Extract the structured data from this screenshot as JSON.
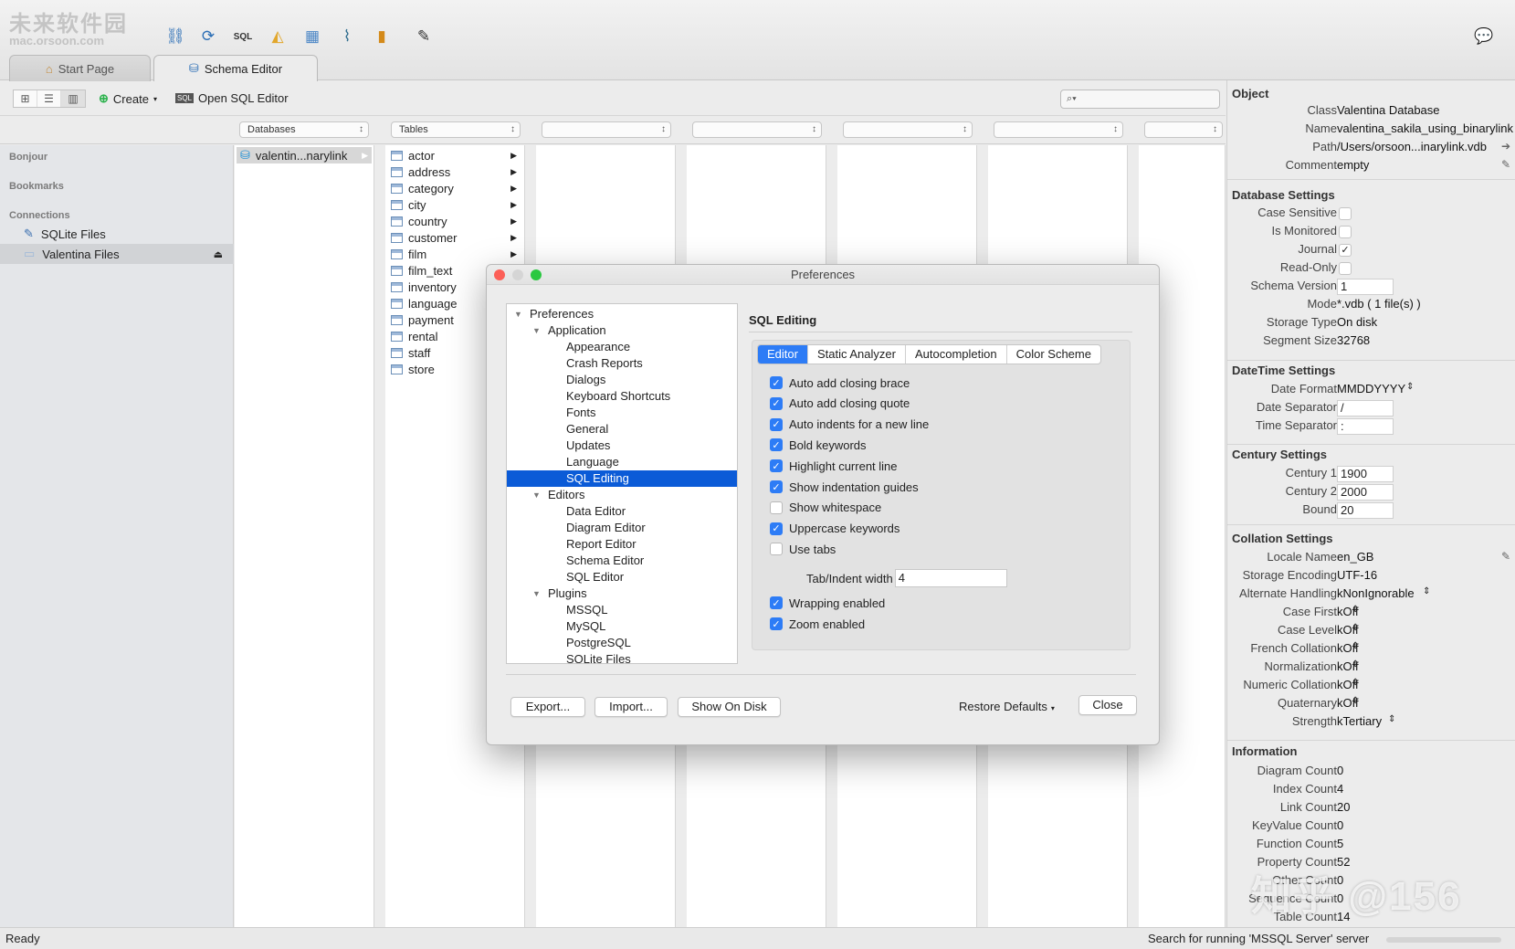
{
  "watermark": {
    "top": "未来软件园",
    "bottom": "mac.orsoon.com",
    "corner": "知乎 @156"
  },
  "tabs": [
    {
      "label": "Start Page"
    },
    {
      "label": "Schema Editor"
    }
  ],
  "subbar": {
    "create": "Create",
    "open_sql": "Open SQL Editor",
    "search_placeholder": ""
  },
  "columns": {
    "databases": "Databases",
    "tables": "Tables"
  },
  "sidebar": {
    "bonjour": "Bonjour",
    "bookmarks": "Bookmarks",
    "connections": "Connections",
    "items": [
      {
        "label": "SQLite Files"
      },
      {
        "label": "Valentina Files"
      }
    ]
  },
  "database_item": "valentin...narylink",
  "tables": [
    "actor",
    "address",
    "category",
    "city",
    "country",
    "customer",
    "film",
    "film_text",
    "inventory",
    "language",
    "payment",
    "rental",
    "staff",
    "store"
  ],
  "dialog": {
    "title": "Preferences",
    "section_title": "SQL Editing",
    "tree": [
      {
        "label": "Preferences",
        "level": 0,
        "expanded": true
      },
      {
        "label": "Application",
        "level": 1,
        "expanded": true
      },
      {
        "label": "Appearance",
        "level": 2
      },
      {
        "label": "Crash Reports",
        "level": 2
      },
      {
        "label": "Dialogs",
        "level": 2
      },
      {
        "label": "Keyboard Shortcuts",
        "level": 2
      },
      {
        "label": "Fonts",
        "level": 2
      },
      {
        "label": "General",
        "level": 2
      },
      {
        "label": "Updates",
        "level": 2
      },
      {
        "label": "Language",
        "level": 2
      },
      {
        "label": "SQL Editing",
        "level": 2,
        "selected": true
      },
      {
        "label": "Editors",
        "level": 1,
        "expanded": true
      },
      {
        "label": "Data Editor",
        "level": 2
      },
      {
        "label": "Diagram Editor",
        "level": 2
      },
      {
        "label": "Report Editor",
        "level": 2
      },
      {
        "label": "Schema Editor",
        "level": 2
      },
      {
        "label": "SQL Editor",
        "level": 2
      },
      {
        "label": "Plugins",
        "level": 1,
        "expanded": true
      },
      {
        "label": "MSSQL",
        "level": 2
      },
      {
        "label": "MySQL",
        "level": 2
      },
      {
        "label": "PostgreSQL",
        "level": 2
      },
      {
        "label": "SQLite Files",
        "level": 2
      }
    ],
    "tabs": [
      {
        "label": "Editor",
        "active": true
      },
      {
        "label": "Static Analyzer"
      },
      {
        "label": "Autocompletion"
      },
      {
        "label": "Color Scheme"
      }
    ],
    "options": [
      {
        "label": "Auto add closing brace",
        "checked": true
      },
      {
        "label": "Auto add closing quote",
        "checked": true
      },
      {
        "label": "Auto indents for a new line",
        "checked": true
      },
      {
        "label": "Bold keywords",
        "checked": true
      },
      {
        "label": "Highlight current line",
        "checked": true
      },
      {
        "label": "Show indentation guides",
        "checked": true
      },
      {
        "label": "Show whitespace",
        "checked": false
      },
      {
        "label": "Uppercase keywords",
        "checked": true
      },
      {
        "label": "Use tabs",
        "checked": false
      }
    ],
    "tab_width_label": "Tab/Indent width",
    "tab_width_value": "4",
    "options2": [
      {
        "label": "Wrapping enabled",
        "checked": true
      },
      {
        "label": "Zoom enabled",
        "checked": true
      }
    ],
    "buttons": {
      "export": "Export...",
      "import": "Import...",
      "show_on_disk": "Show On Disk",
      "restore": "Restore Defaults",
      "close": "Close"
    }
  },
  "panel": {
    "object_title": "Object",
    "object": [
      {
        "k": "Class",
        "v": "Valentina Database"
      },
      {
        "k": "Name",
        "v": "valentina_sakila_using_binarylink"
      },
      {
        "k": "Path",
        "v": "/Users/orsoon...inarylink.vdb"
      },
      {
        "k": "Comment",
        "v": "empty"
      }
    ],
    "db_title": "Database Settings",
    "db": [
      {
        "k": "Case Sensitive",
        "checked": false
      },
      {
        "k": "Is Monitored",
        "checked": false
      },
      {
        "k": "Journal",
        "checked": true
      },
      {
        "k": "Read-Only",
        "checked": false
      }
    ],
    "schema_version_label": "Schema Version",
    "schema_version": "1",
    "db2": [
      {
        "k": "Mode",
        "v": "*.vdb ( 1 file(s) )"
      },
      {
        "k": "Storage Type",
        "v": "On disk"
      },
      {
        "k": "Segment Size",
        "v": "32768"
      }
    ],
    "dt_title": "DateTime Settings",
    "date_format_label": "Date Format",
    "date_format": "MMDDYYYY",
    "date_sep_label": "Date Separator",
    "date_sep": "/",
    "time_sep_label": "Time Separator",
    "time_sep": ":",
    "century_title": "Century Settings",
    "century": [
      {
        "k": "Century 1",
        "v": "1900"
      },
      {
        "k": "Century 2",
        "v": "2000"
      },
      {
        "k": "Bound",
        "v": "20"
      }
    ],
    "coll_title": "Collation Settings",
    "coll": [
      {
        "k": "Locale Name",
        "v": "en_GB"
      },
      {
        "k": "Storage Encoding",
        "v": "UTF-16"
      },
      {
        "k": "Alternate Handling",
        "v": "kNonIgnorable"
      },
      {
        "k": "Case First",
        "v": "kOff"
      },
      {
        "k": "Case Level",
        "v": "kOff"
      },
      {
        "k": "French Collation",
        "v": "kOff"
      },
      {
        "k": "Normalization",
        "v": "kOff"
      },
      {
        "k": "Numeric Collation",
        "v": "kOff"
      },
      {
        "k": "Quaternary",
        "v": "kOff"
      },
      {
        "k": "Strength",
        "v": "kTertiary"
      }
    ],
    "info_title": "Information",
    "info": [
      {
        "k": "Diagram Count",
        "v": "0"
      },
      {
        "k": "Index Count",
        "v": "4"
      },
      {
        "k": "Link Count",
        "v": "20"
      },
      {
        "k": "KeyValue Count",
        "v": "0"
      },
      {
        "k": "Function Count",
        "v": "5"
      },
      {
        "k": "Property Count",
        "v": "52"
      },
      {
        "k": "Other Count",
        "v": "0"
      },
      {
        "k": "Sequence Count",
        "v": "0"
      },
      {
        "k": "Table Count",
        "v": "14"
      }
    ]
  },
  "status": {
    "left": "Ready",
    "right": "Search for running 'MSSQL Server' server"
  }
}
